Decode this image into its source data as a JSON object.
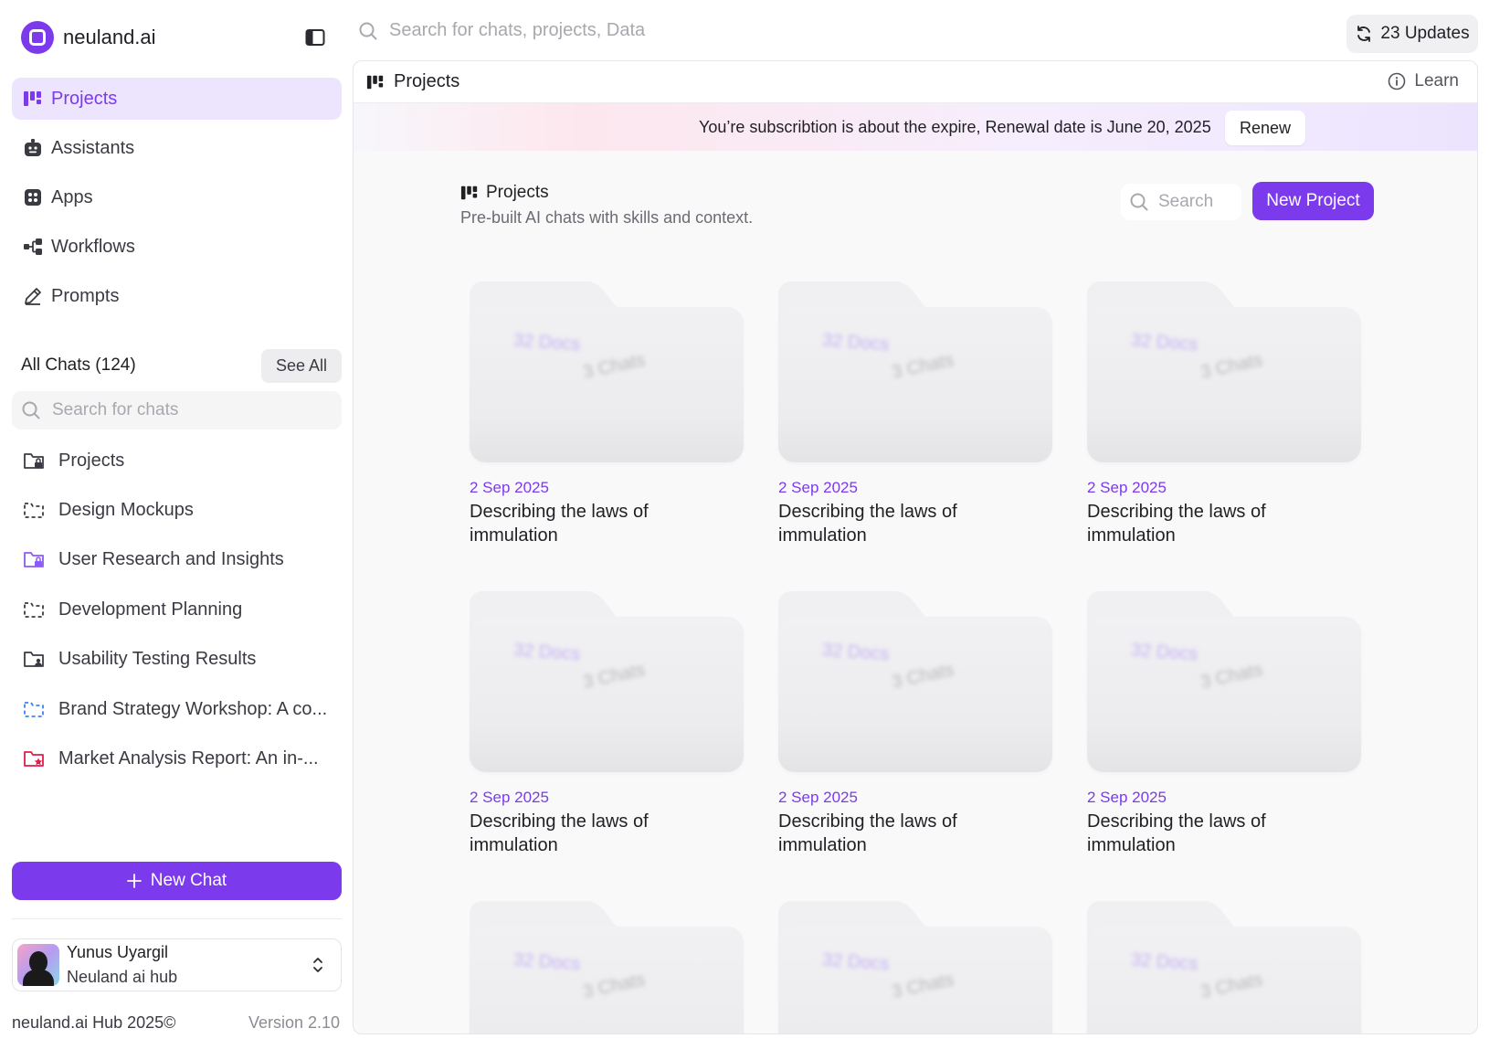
{
  "brand": {
    "name": "neuland.ai"
  },
  "nav": [
    {
      "label": "Projects",
      "icon": "projects-icon",
      "active": true
    },
    {
      "label": "Assistants",
      "icon": "assistant-icon"
    },
    {
      "label": "Apps",
      "icon": "apps-icon"
    },
    {
      "label": "Workflows",
      "icon": "workflow-icon"
    },
    {
      "label": "Prompts",
      "icon": "pencil-icon"
    }
  ],
  "chats": {
    "title": "All Chats (124)",
    "see_all": "See All",
    "search_placeholder": "Search for chats",
    "items": [
      {
        "label": "Projects",
        "icon": "folder-lock-icon",
        "color": "#3a3a42"
      },
      {
        "label": "Design Mockups",
        "icon": "folder-dashed-icon",
        "color": "#3a3a42"
      },
      {
        "label": "User Research and Insights",
        "icon": "folder-lock-icon",
        "color": "#8b5cf6"
      },
      {
        "label": "Development Planning",
        "icon": "folder-dashed-icon",
        "color": "#3a3a42"
      },
      {
        "label": "Usability Testing Results",
        "icon": "folder-user-icon",
        "color": "#3a3a42"
      },
      {
        "label": "Brand Strategy Workshop: A co...",
        "icon": "folder-dashed-icon",
        "color": "#3b82f6"
      },
      {
        "label": "Market Analysis Report: An in-...",
        "icon": "folder-star-icon",
        "color": "#e11d48"
      }
    ]
  },
  "new_chat": "New Chat",
  "user": {
    "name": "Yunus Uyargil",
    "org": "Neuland ai hub"
  },
  "footer": {
    "copyright": "neuland.ai Hub 2025©",
    "version": "Version 2.10"
  },
  "topbar": {
    "search_placeholder": "Search for chats, projects, Data",
    "updates": "23 Updates"
  },
  "panel": {
    "title": "Projects",
    "learn": "Learn",
    "banner": "You’re subscribtion is about the expire, Renewal date is June 20, 2025",
    "renew": "Renew"
  },
  "projects": {
    "title": "Projects",
    "subtitle": "Pre-built AI chats with skills and context.",
    "search_placeholder": "Search",
    "new_project": "New Project",
    "cards": [
      {
        "date": "2 Sep 2025",
        "title": "Describing the laws of immulation",
        "docs": "32 Docs",
        "chats": "3 Chats"
      },
      {
        "date": "2 Sep 2025",
        "title": "Describing the laws of immulation",
        "docs": "32 Docs",
        "chats": "3 Chats"
      },
      {
        "date": "2 Sep 2025",
        "title": "Describing the laws of immulation",
        "docs": "32 Docs",
        "chats": "3 Chats"
      },
      {
        "date": "2 Sep 2025",
        "title": "Describing the laws of immulation",
        "docs": "32 Docs",
        "chats": "3 Chats"
      },
      {
        "date": "2 Sep 2025",
        "title": "Describing the laws of immulation",
        "docs": "32 Docs",
        "chats": "3 Chats"
      },
      {
        "date": "2 Sep 2025",
        "title": "Describing the laws of immulation",
        "docs": "32 Docs",
        "chats": "3 Chats"
      },
      {
        "date": "",
        "title": "",
        "docs": "32 Docs",
        "chats": "3 Chats"
      },
      {
        "date": "",
        "title": "",
        "docs": "32 Docs",
        "chats": "3 Chats"
      },
      {
        "date": "",
        "title": "",
        "docs": "32 Docs",
        "chats": "3 Chats"
      }
    ]
  },
  "colors": {
    "accent": "#7c3aed",
    "accent_soft": "#ede5fd"
  }
}
